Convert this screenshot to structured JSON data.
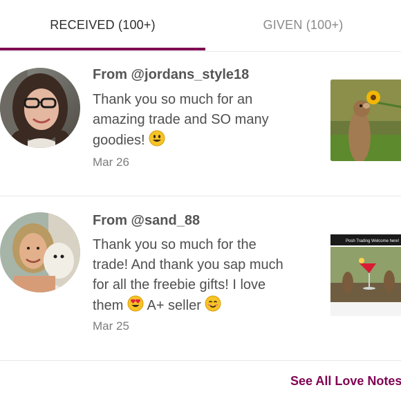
{
  "tabs": {
    "received_label": "RECEIVED (100+)",
    "given_label": "GIVEN (100+)",
    "active": "received"
  },
  "notes": [
    {
      "from": "From @jordans_style18",
      "message_line1": "Thank you so much for an",
      "message_line2": "amazing trade and SO many",
      "message_line3": "goodies!",
      "date": "Mar 26",
      "image_icon": "squirrel-sunflower-photo"
    },
    {
      "from": "From @sand_88",
      "message_line1": "Thank you so much for the",
      "message_line2": "trade! And thank you sap much",
      "message_line3": "for all the freebie gifts! I love",
      "message_line4a": "them",
      "message_line4b": "A+ seller",
      "date": "Mar 25",
      "image_icon": "squirrels-cocktail-photo",
      "image_caption": "Posh Trading Welcome here!"
    }
  ],
  "footer": {
    "see_all_label": "See All Love Notes"
  },
  "colors": {
    "accent": "#7f0353",
    "text": "#4f4f4f",
    "muted": "#7c7c7c",
    "divider": "#e7e7e7"
  }
}
